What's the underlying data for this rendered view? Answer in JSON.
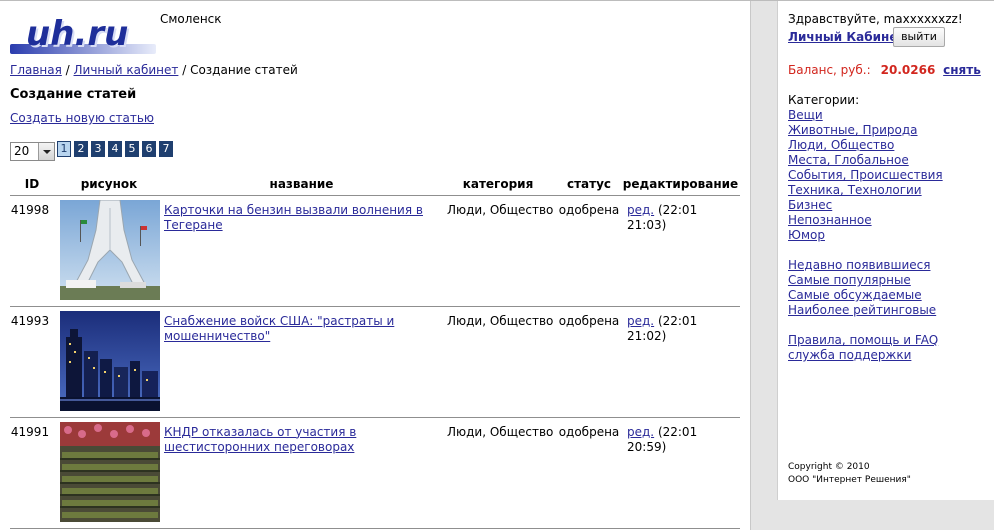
{
  "header": {
    "logo_text": "uh.ru",
    "city": "Смоленск"
  },
  "breadcrumb": {
    "home": "Главная",
    "sep1": " / ",
    "cabinet": "Личный кабинет",
    "sep2": " / ",
    "current": "Создание статей"
  },
  "page": {
    "title": "Создание статей",
    "create_link": "Создать новую статью",
    "per_page": "20"
  },
  "pagination": [
    "1",
    "2",
    "3",
    "4",
    "5",
    "6",
    "7"
  ],
  "table": {
    "headers": {
      "id": "ID",
      "pic": "рисунок",
      "name": "название",
      "cat": "категория",
      "status": "статус",
      "edit": "редактирование"
    },
    "rows": [
      {
        "id": "41998",
        "name": "Карточки на бензин вызвали волнения в Тегеране",
        "category": "Люди, Общество",
        "status": "одобрена",
        "edit": "ред.",
        "date": " (22:01 21:03)",
        "image": "tower-photo"
      },
      {
        "id": "41993",
        "name": "Снабжение войск США: \"растраты и мошенничество\"",
        "category": "Люди, Общество",
        "status": "одобрена",
        "edit": "ред.",
        "date": " (22:01 21:02)",
        "image": "city-night-photo"
      },
      {
        "id": "41991",
        "name": "КНДР отказалась от участия в шестисторонних переговорах",
        "category": "Люди, Общество",
        "status": "одобрена",
        "edit": "ред.",
        "date": " (22:01 20:59)",
        "image": "parade-photo"
      }
    ]
  },
  "sidebar": {
    "greeting": "Здравствуйте, maxxxxxxzz!",
    "cabinet_link": "Личный Кабинет",
    "exit_button": "выйти",
    "balance_label": "Баланс, руб.:",
    "balance_value": "20.0266",
    "withdraw": "снять",
    "categories_title": "Категории:",
    "categories": [
      "Вещи",
      "Животные, Природа",
      "Люди, Общество",
      "Места, Глобальное",
      "События, Происшествия",
      "Техника, Технологии",
      "Бизнес",
      "Непознанное",
      "Юмор"
    ],
    "lists": [
      "Недавно появившиеся",
      "Самые популярные",
      "Самые обсуждаемые",
      "Наиболее рейтинговые"
    ],
    "help": [
      "Правила, помощь и FAQ",
      "служба поддержки"
    ],
    "copyright": "Copyright © 2010",
    "company": "ООО \"Интернет Решения\""
  },
  "colors": {
    "link": "#2a2a99",
    "balance": "#d2261e",
    "page_button": "#1f3f6f"
  }
}
